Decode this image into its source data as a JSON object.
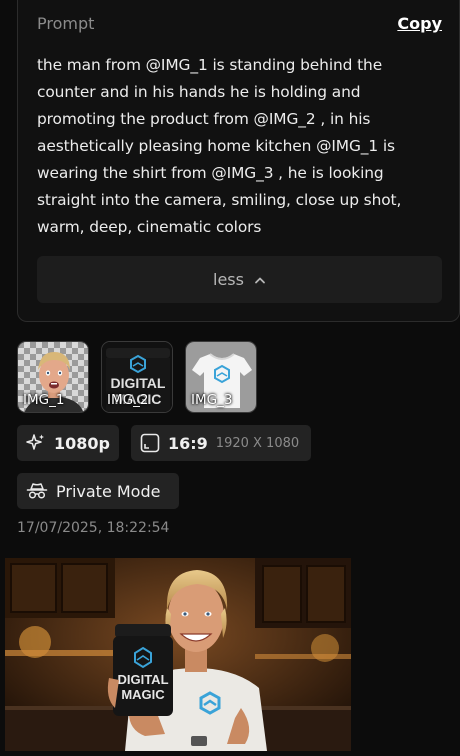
{
  "prompt": {
    "label": "Prompt",
    "copy_label": "Copy",
    "lines": [
      "the man from @IMG_1 is standing behind the",
      "counter and in his hands he is holding and",
      "promoting the product from @IMG_2 , in his",
      "aesthetically pleasing home kitchen @IMG_1 is",
      "wearing the shirt from @IMG_3 , he is looking",
      "straight into the camera, smiling, close up shot,",
      "warm, deep, cinematic colors"
    ],
    "less_label": "less"
  },
  "references": [
    {
      "label": "IMG_1"
    },
    {
      "label": "IMG_2"
    },
    {
      "label": "IMG_3"
    }
  ],
  "product_logo": {
    "line1": "DIGITAL",
    "line2": "MAGIC"
  },
  "settings": {
    "quality": "1080p",
    "aspect_ratio": "16:9",
    "resolution": "1920 X 1080",
    "privacy": "Private Mode"
  },
  "timestamp": "17/07/2025, 18:22:54",
  "colors": {
    "background": "#0c0c0c",
    "card": "#111111",
    "chip": "#232323",
    "accent_logo": "#3aa3d8"
  }
}
